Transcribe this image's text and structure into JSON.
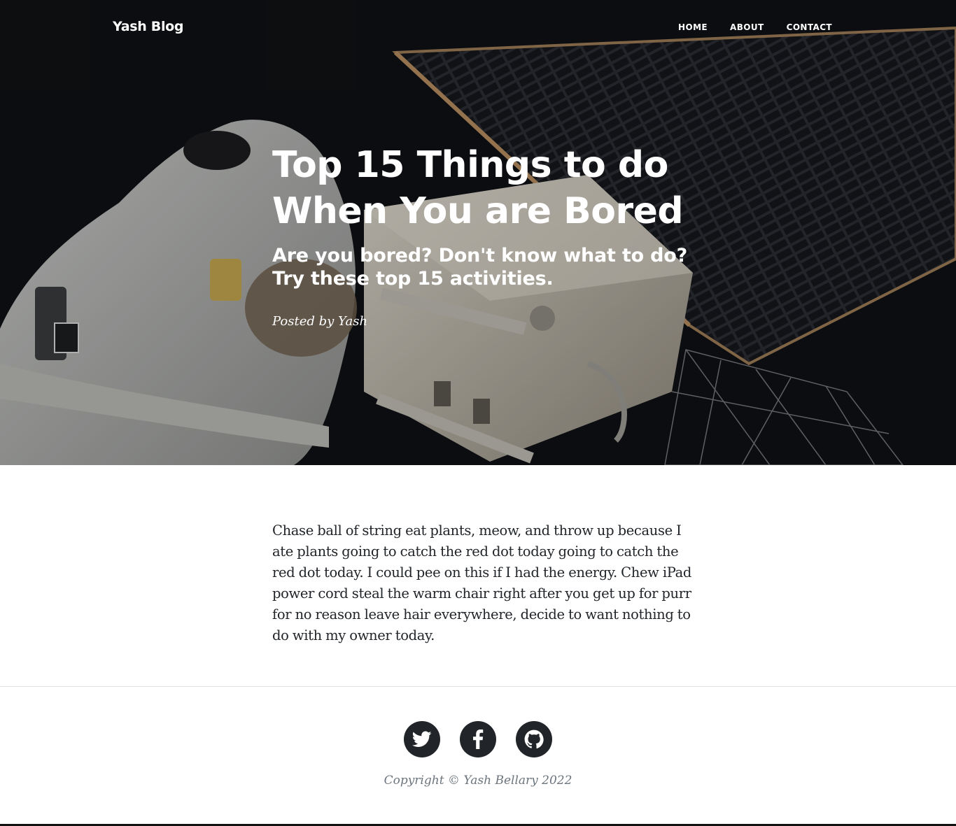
{
  "nav": {
    "brand": "Yash Blog",
    "links": [
      "HOME",
      "ABOUT",
      "CONTACT"
    ]
  },
  "post": {
    "title": "Top 15 Things to do When You are Bored",
    "subtitle": "Are you bored? Don't know what to do? Try these top 15 activities.",
    "meta": "Posted by Yash",
    "hero_image_icon": "astronaut-space-station-image"
  },
  "article": {
    "body": "Chase ball of string eat plants, meow, and throw up because I ate plants going to catch the red dot today going to catch the red dot today. I could pee on this if I had the energy. Chew iPad power cord steal the warm chair right after you get up for purr for no reason leave hair everywhere, decide to want nothing to do with my owner today."
  },
  "footer": {
    "social": [
      {
        "icon": "twitter-icon"
      },
      {
        "icon": "facebook-icon"
      },
      {
        "icon": "github-icon"
      }
    ],
    "copyright": "Copyright © Yash Bellary 2022"
  },
  "colors": {
    "hero_background": "#0f1114",
    "text_dark": "#212529",
    "muted": "#6c757d",
    "social_button": "#212529"
  }
}
